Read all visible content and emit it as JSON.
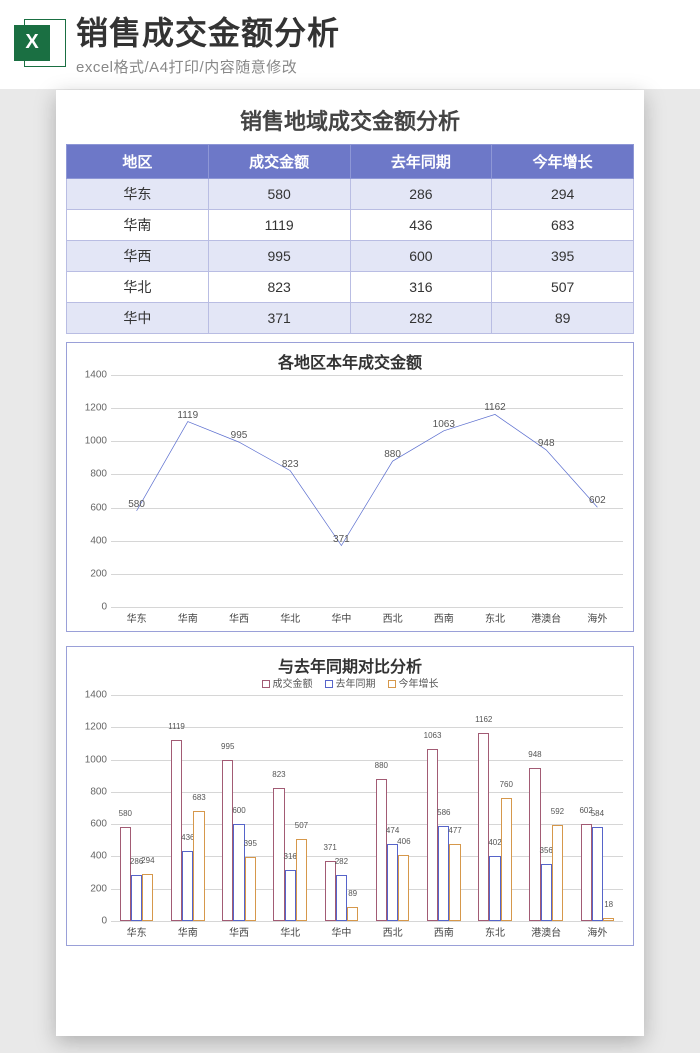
{
  "header": {
    "title": "销售成交金额分析",
    "subtitle": "excel格式/A4打印/内容随意修改",
    "icon_letter": "X"
  },
  "sheet": {
    "main_title": "销售地域成交金额分析",
    "table": {
      "headers": [
        "地区",
        "成交金额",
        "去年同期",
        "今年增长"
      ],
      "rows": [
        {
          "region": "华东",
          "amount": 580,
          "last": 286,
          "growth": 294
        },
        {
          "region": "华南",
          "amount": 1119,
          "last": 436,
          "growth": 683
        },
        {
          "region": "华西",
          "amount": 995,
          "last": 600,
          "growth": 395
        },
        {
          "region": "华北",
          "amount": 823,
          "last": 316,
          "growth": 507
        },
        {
          "region": "华中",
          "amount": 371,
          "last": 282,
          "growth": 89
        }
      ]
    },
    "chart1_title": "各地区本年成交金额",
    "chart2_title": "与去年同期对比分析",
    "legend": [
      "成交金额",
      "去年同期",
      "今年增长"
    ]
  },
  "chart_data": [
    {
      "type": "line",
      "title": "各地区本年成交金额",
      "xlabel": "",
      "ylabel": "",
      "ylim": [
        0,
        1400
      ],
      "y_ticks": [
        0,
        200,
        400,
        600,
        800,
        1000,
        1200,
        1400
      ],
      "categories": [
        "华东",
        "华南",
        "华西",
        "华北",
        "华中",
        "西北",
        "西南",
        "东北",
        "港澳台",
        "海外"
      ],
      "values": [
        580,
        1119,
        995,
        823,
        371,
        880,
        1063,
        1162,
        948,
        602
      ]
    },
    {
      "type": "bar",
      "title": "与去年同期对比分析",
      "xlabel": "",
      "ylabel": "",
      "ylim": [
        0,
        1400
      ],
      "y_ticks": [
        0,
        200,
        400,
        600,
        800,
        1000,
        1200,
        1400
      ],
      "categories": [
        "华东",
        "华南",
        "华西",
        "华北",
        "华中",
        "西北",
        "西南",
        "东北",
        "港澳台",
        "海外"
      ],
      "series": [
        {
          "name": "成交金额",
          "values": [
            580,
            1119,
            995,
            823,
            371,
            880,
            1063,
            1162,
            948,
            602
          ]
        },
        {
          "name": "去年同期",
          "values": [
            286,
            436,
            600,
            316,
            282,
            474,
            586,
            402,
            356,
            584
          ]
        },
        {
          "name": "今年增长",
          "values": [
            294,
            683,
            395,
            507,
            89,
            406,
            477,
            760,
            592,
            18
          ]
        }
      ]
    }
  ]
}
